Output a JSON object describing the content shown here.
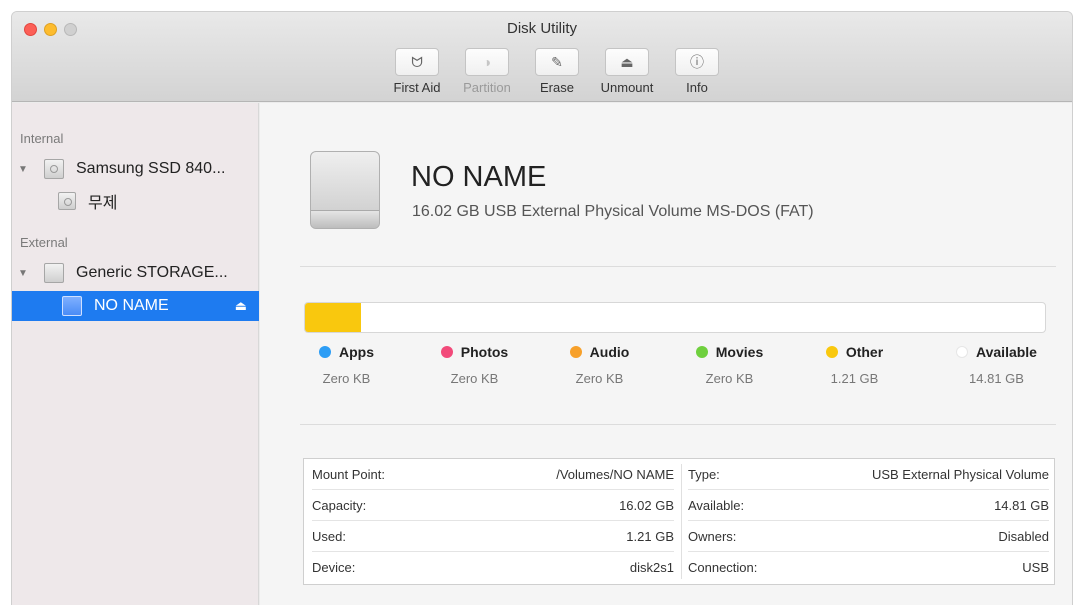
{
  "window": {
    "title": "Disk Utility"
  },
  "toolbar": {
    "buttons": [
      {
        "label": "First Aid",
        "icon": "stethoscope-icon",
        "enabled": true
      },
      {
        "label": "Partition",
        "icon": "partition-icon",
        "enabled": false
      },
      {
        "label": "Erase",
        "icon": "erase-icon",
        "enabled": true
      },
      {
        "label": "Unmount",
        "icon": "unmount-icon",
        "enabled": true
      },
      {
        "label": "Info",
        "icon": "info-icon",
        "enabled": true
      }
    ]
  },
  "sidebar": {
    "internal_header": "Internal",
    "external_header": "External",
    "items": [
      {
        "label": "Samsung SSD 840..."
      },
      {
        "label": "무제"
      },
      {
        "label": "Generic STORAGE..."
      },
      {
        "label": "NO NAME",
        "selected": true
      }
    ]
  },
  "volume": {
    "name": "NO NAME",
    "description": "16.02 GB USB External Physical Volume MS-DOS (FAT)"
  },
  "usage": {
    "used_fraction": 0.0755,
    "fill_color": "#f9c80e",
    "categories": [
      {
        "label": "Apps",
        "value": "Zero KB",
        "color": "#2d9df5"
      },
      {
        "label": "Photos",
        "value": "Zero KB",
        "color": "#f24a7a"
      },
      {
        "label": "Audio",
        "value": "Zero KB",
        "color": "#f7a02a"
      },
      {
        "label": "Movies",
        "value": "Zero KB",
        "color": "#6fd03e"
      },
      {
        "label": "Other",
        "value": "1.21 GB",
        "color": "#f9c80e"
      },
      {
        "label": "Available",
        "value": "14.81 GB",
        "color": "#ffffff"
      }
    ]
  },
  "info": {
    "rows": [
      {
        "left_key": "Mount Point:",
        "left_val": "/Volumes/NO NAME",
        "right_key": "Type:",
        "right_val": "USB External Physical Volume"
      },
      {
        "left_key": "Capacity:",
        "left_val": "16.02 GB",
        "right_key": "Available:",
        "right_val": "14.81 GB"
      },
      {
        "left_key": "Used:",
        "left_val": "1.21 GB",
        "right_key": "Owners:",
        "right_val": "Disabled"
      },
      {
        "left_key": "Device:",
        "left_val": "disk2s1",
        "right_key": "Connection:",
        "right_val": "USB"
      }
    ]
  }
}
